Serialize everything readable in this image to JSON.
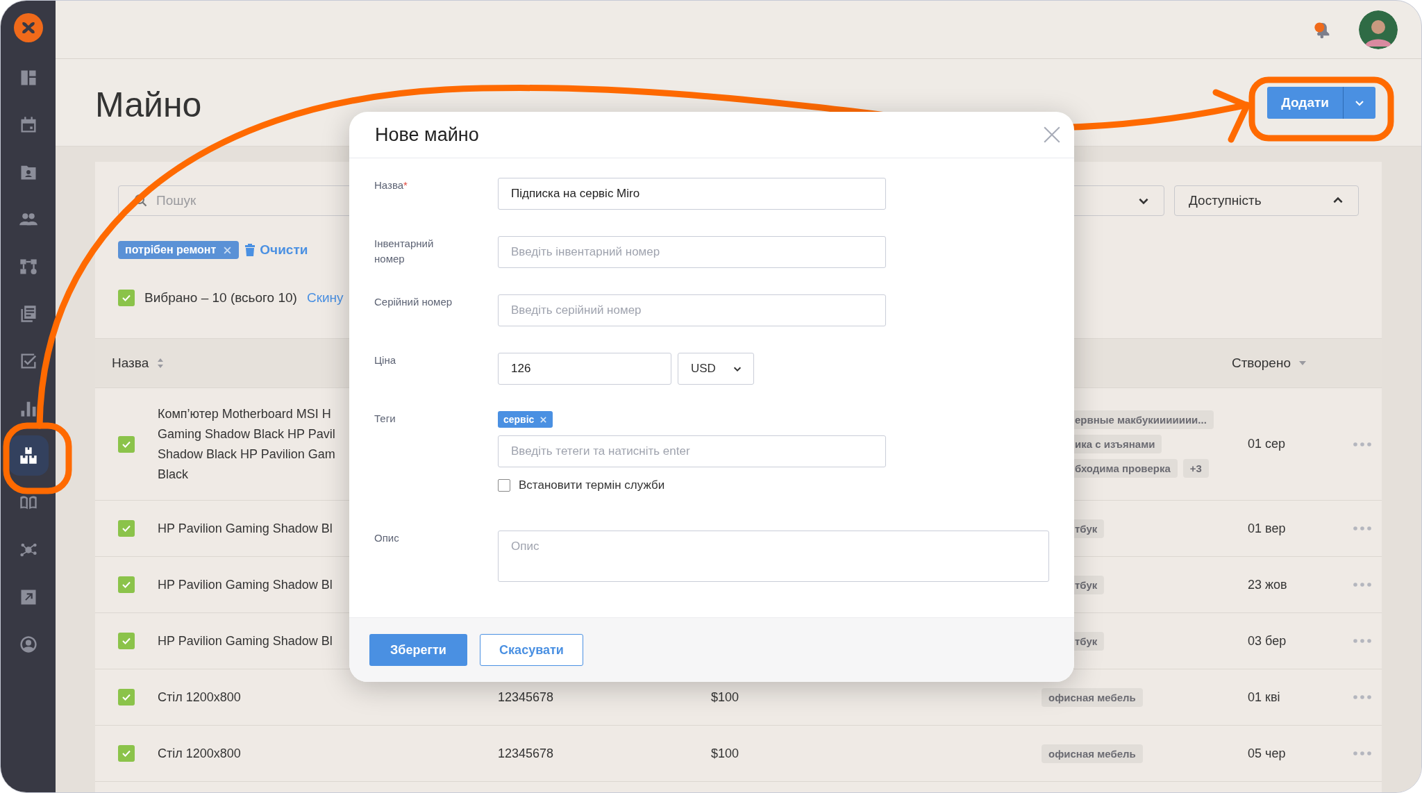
{
  "sidebar": {
    "items": [
      {
        "kind": "dashboard",
        "selected": false
      },
      {
        "kind": "calendar",
        "selected": false
      },
      {
        "kind": "contacts",
        "selected": false
      },
      {
        "kind": "people",
        "selected": false
      },
      {
        "kind": "structure",
        "selected": false
      },
      {
        "kind": "documents",
        "selected": false
      },
      {
        "kind": "tasks",
        "selected": false
      },
      {
        "kind": "reports",
        "selected": false
      },
      {
        "kind": "assets",
        "selected": true
      },
      {
        "kind": "book",
        "selected": false
      },
      {
        "kind": "network",
        "selected": false
      },
      {
        "kind": "export",
        "selected": false
      },
      {
        "kind": "profile",
        "selected": false
      }
    ]
  },
  "header": {
    "title": "Майно",
    "add_button": "Додати"
  },
  "filters": {
    "search_placeholder": "Пошук",
    "availability": "Доступність",
    "active_tags": [
      {
        "label": "потрібен ремонт"
      }
    ],
    "clear_link": "Очисти"
  },
  "selection": {
    "checked": true,
    "label": "Вибрано – 10 (всього 10)",
    "reset_link": "Скину"
  },
  "table": {
    "columns": [
      {
        "label": "Назва",
        "kind": "sortable"
      },
      {
        "label": "Створено",
        "kind": "sorted"
      }
    ],
    "rows": [
      {
        "checked": true,
        "name_lines": [
          "Комп’ютер Motherboard MSI H",
          "Gaming Shadow Black HP Pavil",
          "Shadow Black HP Pavilion Gam",
          "Black"
        ],
        "tags": [
          {
            "label": "ервные макбукиииииии...",
            "cut": true
          },
          {
            "label": "ика с изъянами",
            "cut": true
          },
          {
            "label": "бходима проверка",
            "cut": true
          }
        ],
        "more_tags": "+3",
        "created": "01 сер"
      },
      {
        "checked": true,
        "name_lines": [
          "HP Pavilion Gaming Shadow Bl"
        ],
        "tags": [
          {
            "label": "тбук",
            "cut": true
          }
        ],
        "created": "01 вер"
      },
      {
        "checked": true,
        "name_lines": [
          "HP Pavilion Gaming Shadow Bl"
        ],
        "tags": [
          {
            "label": "тбук",
            "cut": true
          }
        ],
        "created": "23 жов"
      },
      {
        "checked": true,
        "name_lines": [
          "HP Pavilion Gaming Shadow Bl"
        ],
        "tags": [
          {
            "label": "тбук",
            "cut": true
          }
        ],
        "created": "03 бер"
      },
      {
        "checked": true,
        "name_lines": [
          "Стіл 1200x800"
        ],
        "inventory": "12345678",
        "price": "$100",
        "tags": [
          {
            "label": "офисная мебель",
            "cut": false
          }
        ],
        "created": "01 кві"
      },
      {
        "checked": true,
        "name_lines": [
          "Стіл 1200x800"
        ],
        "inventory": "12345678",
        "price": "$100",
        "tags": [
          {
            "label": "офисная мебель",
            "cut": false
          }
        ],
        "created": "05 чер"
      }
    ]
  },
  "modal": {
    "title": "Нове майно",
    "fields": [
      {
        "kind": "text",
        "label": "Назва",
        "required_mark": "*",
        "value": "Підписка на сервіс Miro"
      },
      {
        "kind": "text",
        "label": "Інвентарний номер",
        "placeholder": "Введіть інвентарний номер"
      },
      {
        "kind": "text",
        "label": "Серійний номер",
        "placeholder": "Введіть серійний номер"
      },
      {
        "kind": "price",
        "label": "Ціна",
        "value": "126",
        "currency": "USD"
      },
      {
        "kind": "tags",
        "label": "Теги",
        "tags": [
          "сервіс"
        ],
        "placeholder": "Введіть тетеги та натисніть enter",
        "option": {
          "label": "Встановити термін служби",
          "checked": false
        }
      },
      {
        "kind": "textarea",
        "label": "Опис",
        "placeholder": "Опис"
      }
    ],
    "save_button": "Зберегти",
    "cancel_button": "Скасувати"
  }
}
